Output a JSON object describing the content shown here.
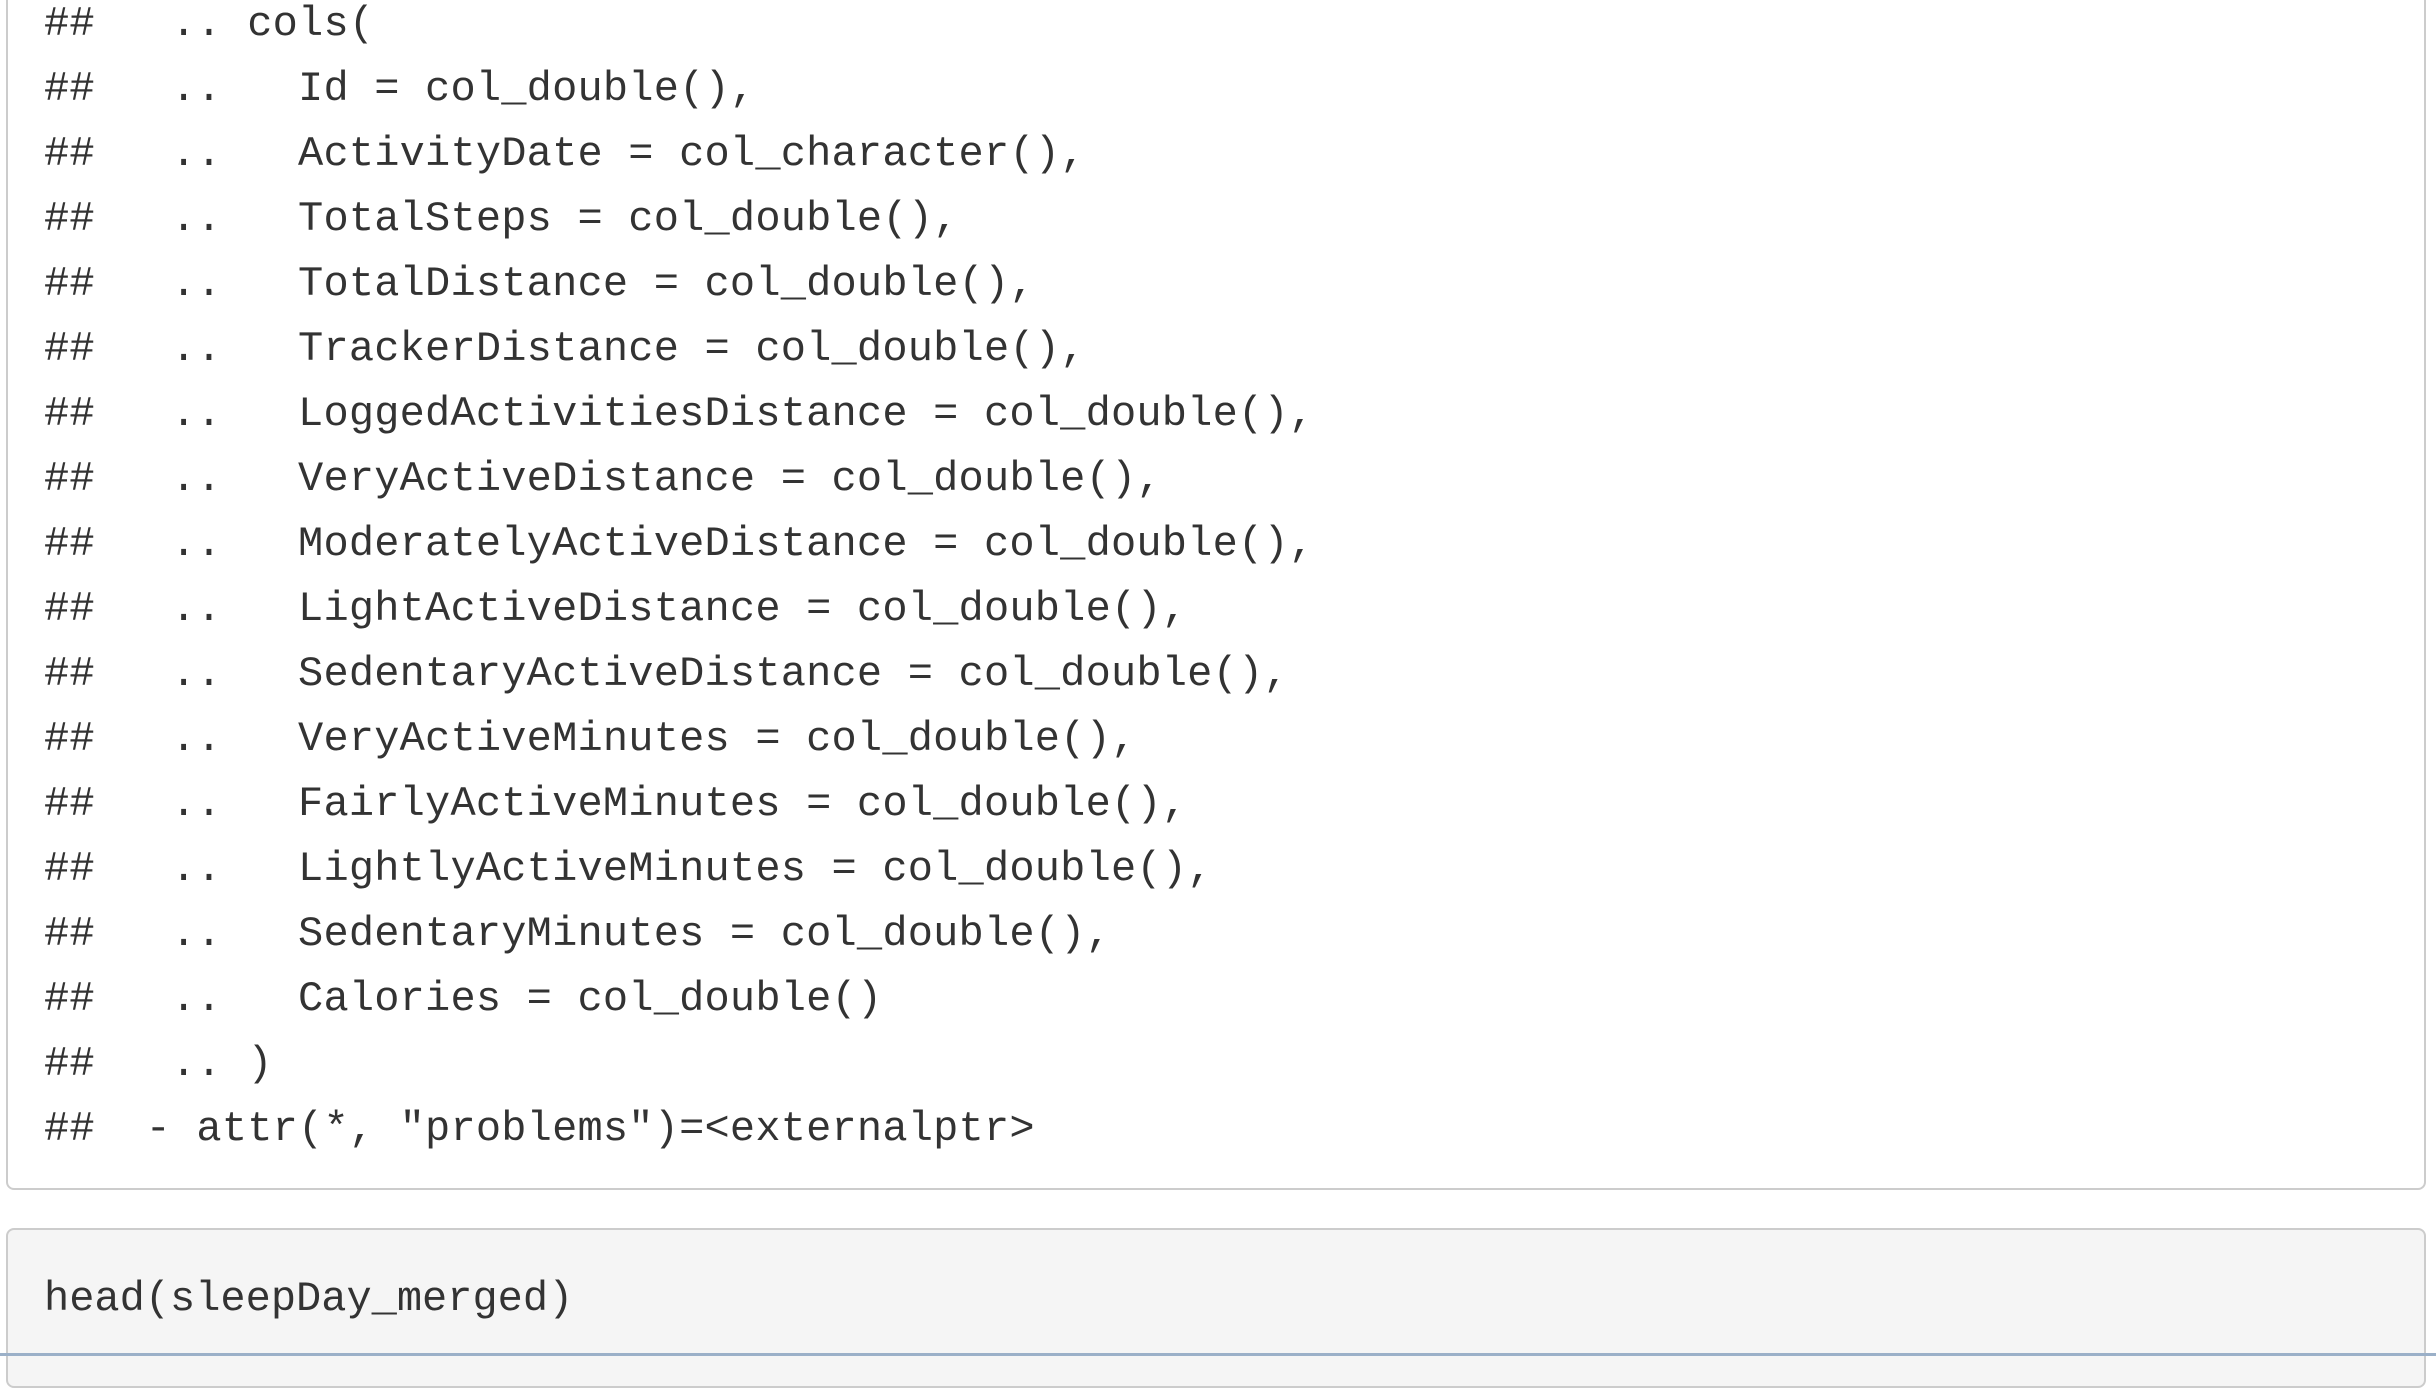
{
  "output": {
    "lines": [
      "##   .. cols(",
      "##   ..   Id = col_double(),",
      "##   ..   ActivityDate = col_character(),",
      "##   ..   TotalSteps = col_double(),",
      "##   ..   TotalDistance = col_double(),",
      "##   ..   TrackerDistance = col_double(),",
      "##   ..   LoggedActivitiesDistance = col_double(),",
      "##   ..   VeryActiveDistance = col_double(),",
      "##   ..   ModeratelyActiveDistance = col_double(),",
      "##   ..   LightActiveDistance = col_double(),",
      "##   ..   SedentaryActiveDistance = col_double(),",
      "##   ..   VeryActiveMinutes = col_double(),",
      "##   ..   FairlyActiveMinutes = col_double(),",
      "##   ..   LightlyActiveMinutes = col_double(),",
      "##   ..   SedentaryMinutes = col_double(),",
      "##   ..   Calories = col_double()",
      "##   .. )",
      "##  - attr(*, \"problems\")=<externalptr>"
    ]
  },
  "code": {
    "text": "head(sleepDay_merged)"
  }
}
